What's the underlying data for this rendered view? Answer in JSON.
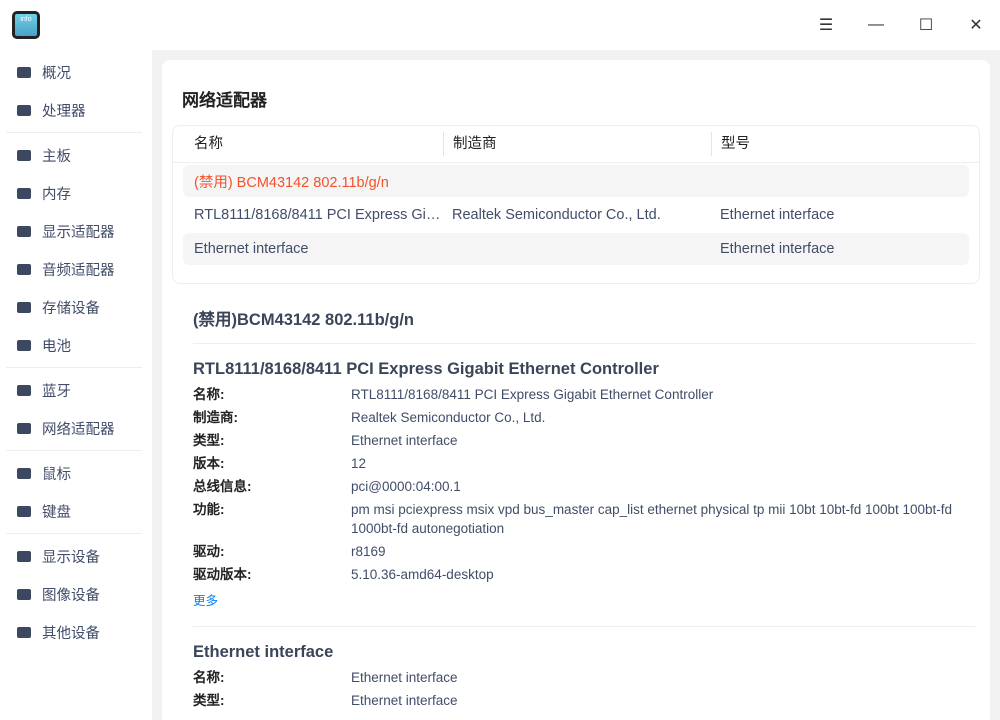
{
  "app": {
    "logo_text": "info"
  },
  "window": {
    "menu": "☰",
    "minimize": "—",
    "maximize": "☐",
    "close": "✕"
  },
  "sidebar": {
    "groups": [
      [
        {
          "label": "概况",
          "icon": "overview-icon"
        },
        {
          "label": "处理器",
          "icon": "cpu-icon"
        }
      ],
      [
        {
          "label": "主板",
          "icon": "motherboard-icon"
        },
        {
          "label": "内存",
          "icon": "memory-icon"
        },
        {
          "label": "显示适配器",
          "icon": "display-adapter-icon"
        },
        {
          "label": "音频适配器",
          "icon": "audio-icon"
        },
        {
          "label": "存储设备",
          "icon": "storage-icon"
        },
        {
          "label": "电池",
          "icon": "battery-icon"
        }
      ],
      [
        {
          "label": "蓝牙",
          "icon": "bluetooth-icon"
        },
        {
          "label": "网络适配器",
          "icon": "network-icon"
        }
      ],
      [
        {
          "label": "鼠标",
          "icon": "mouse-icon"
        },
        {
          "label": "键盘",
          "icon": "keyboard-icon"
        }
      ],
      [
        {
          "label": "显示设备",
          "icon": "monitor-icon"
        },
        {
          "label": "图像设备",
          "icon": "camera-icon"
        },
        {
          "label": "其他设备",
          "icon": "other-device-icon"
        }
      ]
    ]
  },
  "main": {
    "title": "网络适配器",
    "table": {
      "headers": [
        "名称",
        "制造商",
        "型号"
      ],
      "rows": [
        [
          "(禁用) BCM43142 802.11b/g/n",
          "",
          ""
        ],
        [
          "RTL8111/8168/8411 PCI Express Gigabit Ethernet Controller",
          "Realtek Semiconductor Co., Ltd.",
          "Ethernet interface"
        ],
        [
          "Ethernet interface",
          "",
          "Ethernet interface"
        ]
      ]
    },
    "details": [
      {
        "title": "(禁用)BCM43142 802.11b/g/n"
      },
      {
        "title": "RTL8111/8168/8411 PCI Express Gigabit Ethernet Controller",
        "fields": [
          [
            "名称:",
            "RTL8111/8168/8411 PCI Express Gigabit Ethernet Controller"
          ],
          [
            "制造商:",
            "Realtek Semiconductor Co., Ltd."
          ],
          [
            "类型:",
            "Ethernet interface"
          ],
          [
            "版本:",
            "12"
          ],
          [
            "总线信息:",
            "pci@0000:04:00.1"
          ],
          [
            "功能:",
            "pm msi pciexpress msix vpd bus_master cap_list ethernet physical tp mii 10bt 10bt-fd 100bt 100bt-fd 1000bt-fd autonegotiation"
          ],
          [
            "驱动:",
            "r8169"
          ],
          [
            "驱动版本:",
            "5.10.36-amd64-desktop"
          ]
        ],
        "more": "更多"
      },
      {
        "title": "Ethernet interface",
        "fields": [
          [
            "名称:",
            "Ethernet interface"
          ],
          [
            "类型:",
            "Ethernet interface"
          ]
        ]
      }
    ]
  },
  "colors": {
    "disabled": "#f5512b",
    "link": "#0081ff"
  }
}
